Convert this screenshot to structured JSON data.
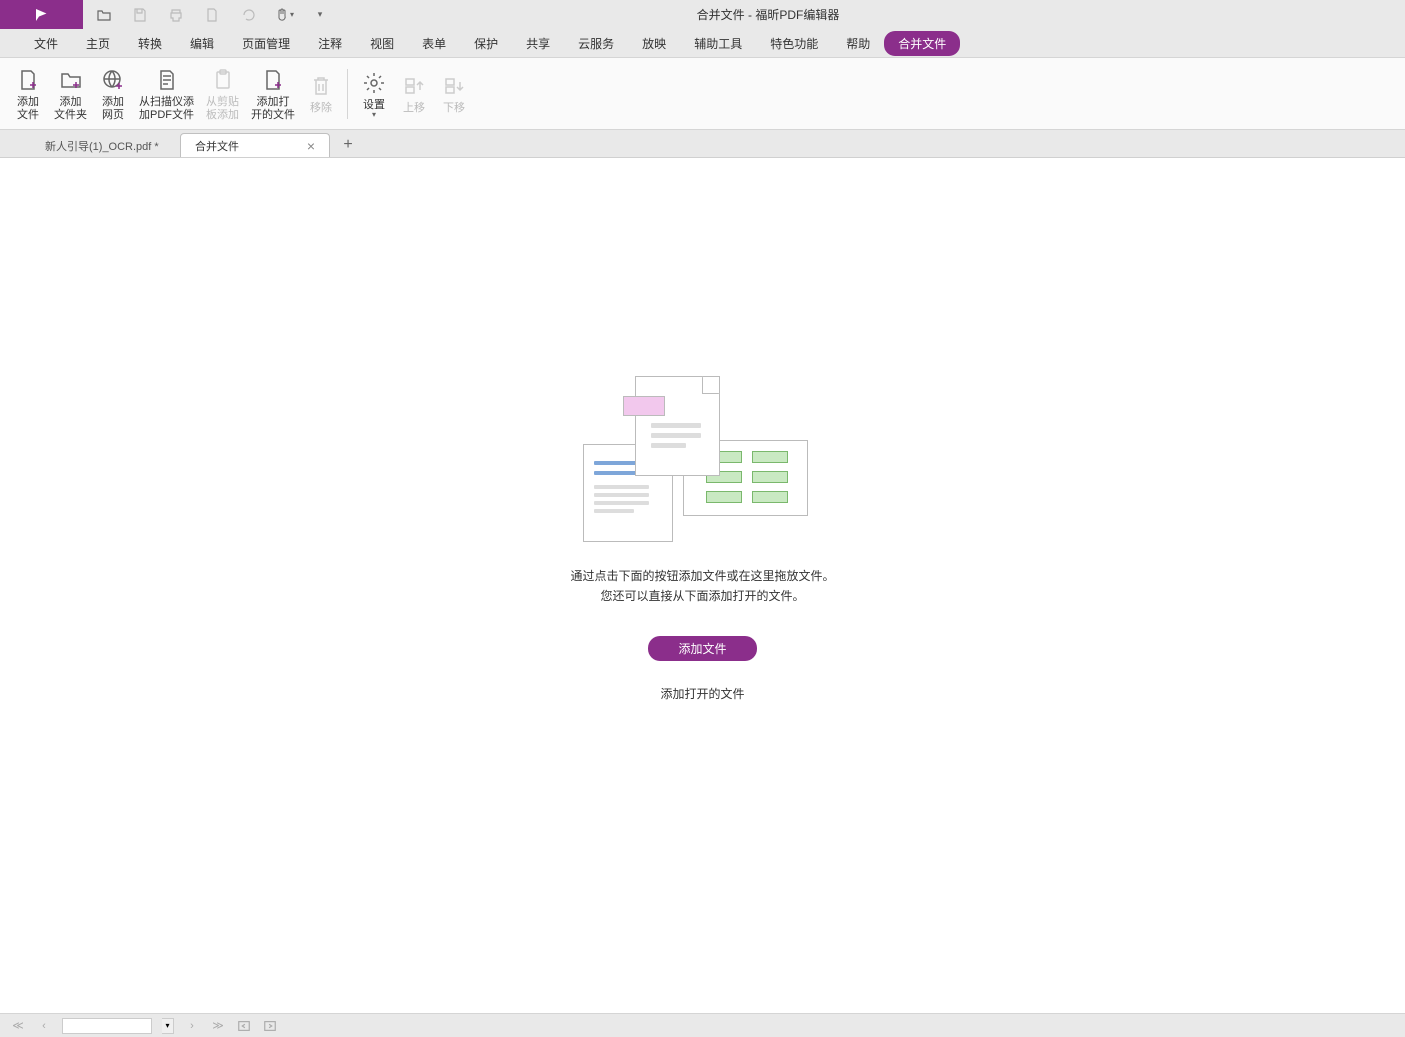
{
  "titlebar": {
    "title": "合并文件 - 福昕PDF编辑器"
  },
  "menu": {
    "items": [
      "文件",
      "主页",
      "转换",
      "编辑",
      "页面管理",
      "注释",
      "视图",
      "表单",
      "保护",
      "共享",
      "云服务",
      "放映",
      "辅助工具",
      "特色功能",
      "帮助",
      "合并文件"
    ],
    "active_index": 15
  },
  "ribbon": {
    "add_file": "添加\n文件",
    "add_folder": "添加\n文件夹",
    "add_webpage": "添加\n网页",
    "from_scanner": "从扫描仪添\n加PDF文件",
    "from_clipboard": "从剪贴\n板添加",
    "add_open": "添加打\n开的文件",
    "remove": "移除",
    "settings": "设置",
    "move_up": "上移",
    "move_down": "下移"
  },
  "tabs": {
    "items": [
      {
        "label": "新人引导(1)_OCR.pdf *",
        "active": false
      },
      {
        "label": "合并文件",
        "active": true
      }
    ]
  },
  "empty": {
    "line1": "通过点击下面的按钮添加文件或在这里拖放文件。",
    "line2": "您还可以直接从下面添加打开的文件。",
    "add_file_btn": "添加文件",
    "add_open_btn": "添加打开的文件"
  }
}
